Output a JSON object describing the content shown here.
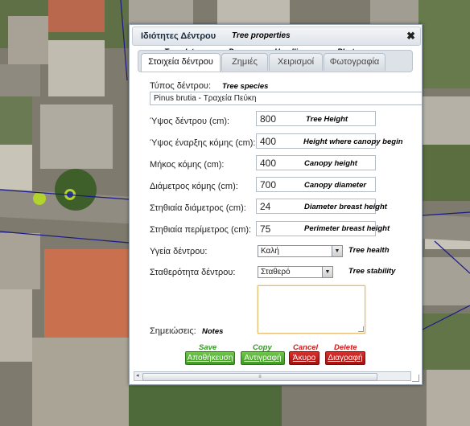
{
  "colors": {
    "save": "#3e9a22",
    "cancel": "#a5110f",
    "save_annot": "#2f9a1f",
    "delete_annot": "#d01818"
  },
  "dialog": {
    "title": "Ιδιότητες Δέντρου",
    "title_en": "Tree properties",
    "close_icon": "close-icon",
    "tabs": [
      {
        "label": "Στοιχεία δέντρου",
        "annot": "Tree data",
        "active": true
      },
      {
        "label": "Ζημιές",
        "annot": "Damages"
      },
      {
        "label": "Χειρισμοί",
        "annot": "Handlings"
      },
      {
        "label": "Φωτογραφία",
        "annot": "Photo"
      }
    ],
    "species": {
      "label": "Τύπος δέντρου:",
      "annot": "Tree species",
      "value": "Pinus brutia - Τραχεία Πεύκη"
    },
    "fields": [
      {
        "label": "Ύψος δέντρου (cm):",
        "value": "800",
        "annot": "Tree Height"
      },
      {
        "label": "Ύψος έναρξης κόμης (cm):",
        "value": "400",
        "annot": "Height where canopy begin"
      },
      {
        "label": "Μήκος κόμης (cm):",
        "value": "400",
        "annot": "Canopy height"
      },
      {
        "label": "Διάμετρος κόμης (cm):",
        "value": "700",
        "annot": "Canopy diameter"
      },
      {
        "label": "Στηθιαία διάμετρος (cm):",
        "value": "24",
        "annot": "Diameter breast height"
      },
      {
        "label": "Στηθιαία περίμετρος (cm):",
        "value": "75",
        "annot": "Perimeter breast height"
      }
    ],
    "health": {
      "label": "Υγεία δέντρου:",
      "value": "Καλή",
      "annot": "Tree health"
    },
    "stability": {
      "label": "Σταθερότητα δέντρου:",
      "value": "Σταθερό",
      "annot": "Tree stability"
    },
    "notes": {
      "label": "Σημειώσεις:",
      "annot": "Notes",
      "value": ""
    },
    "buttons": {
      "save": {
        "label": "Αποθήκευση",
        "annot": "Save"
      },
      "copy": {
        "label": "Αντιγραφή",
        "annot": "Copy"
      },
      "cancel": {
        "label": "Άκυρο",
        "annot": "Cancel"
      },
      "delete": {
        "label": "Διαγραφή",
        "annot": "Delete"
      }
    }
  }
}
